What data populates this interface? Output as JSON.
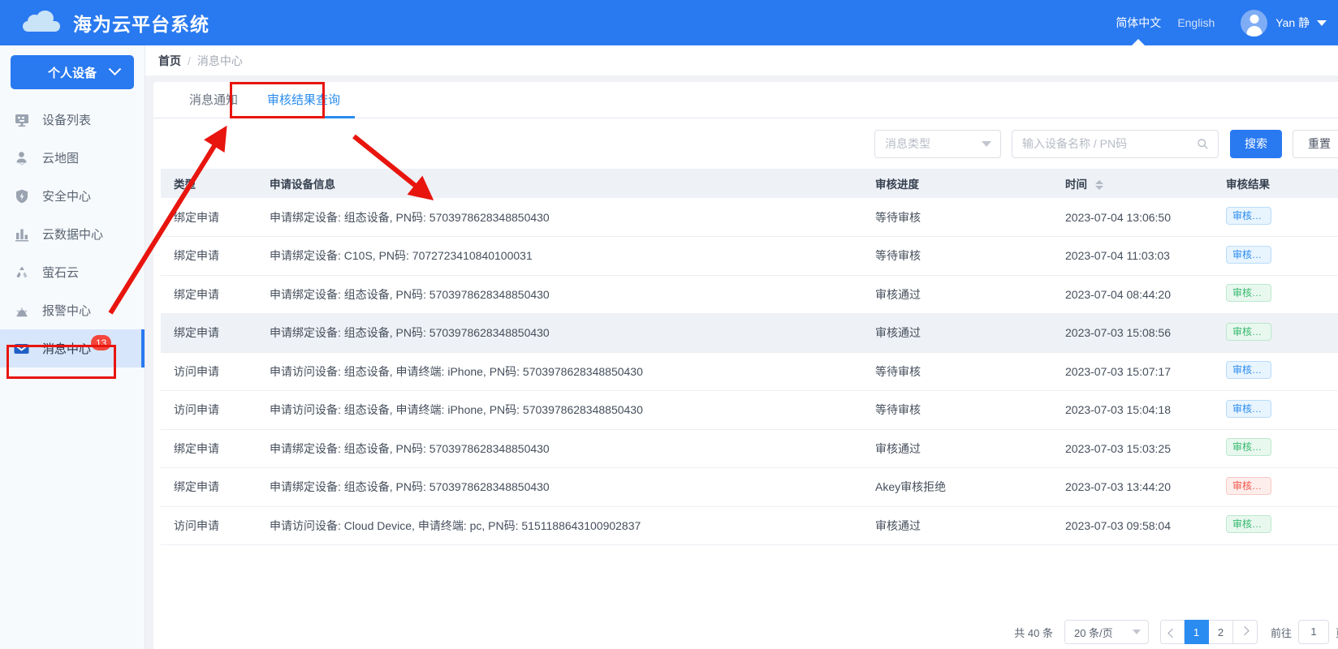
{
  "header": {
    "brand_title": "海为云平台系统",
    "lang_zh": "简体中文",
    "lang_en": "English",
    "user_name": "Yan 静",
    "brand_color": "#2979f0"
  },
  "sidebar": {
    "device_selector": "个人设备",
    "items": [
      {
        "label": "设备列表",
        "icon": "monitor-icon",
        "active": false
      },
      {
        "label": "云地图",
        "icon": "map-pin-icon",
        "active": false
      },
      {
        "label": "安全中心",
        "icon": "shield-icon",
        "active": false
      },
      {
        "label": "云数据中心",
        "icon": "bar-chart-icon",
        "active": false
      },
      {
        "label": "萤石云",
        "icon": "cloud-recycle-icon",
        "active": false
      },
      {
        "label": "报警中心",
        "icon": "alarm-icon",
        "active": false
      },
      {
        "label": "消息中心",
        "icon": "envelope-icon",
        "active": true,
        "badge": "13"
      }
    ]
  },
  "breadcrumb": {
    "home": "首页",
    "separator": "/",
    "current": "消息中心"
  },
  "tabs": [
    {
      "label": "消息通知",
      "active": false
    },
    {
      "label": "审核结果查询",
      "active": true
    }
  ],
  "toolbar": {
    "type_filter_placeholder": "消息类型",
    "search_placeholder": "输入设备名称 / PN码",
    "search_value": "",
    "search_button": "搜索",
    "reset_button": "重置",
    "search_icon": "magnifier-icon"
  },
  "table": {
    "columns": [
      "类型",
      "申请设备信息",
      "审核进度",
      "时间",
      "审核结果"
    ],
    "sortable_column": "时间",
    "rows": [
      {
        "type": "绑定申请",
        "info": "申请绑定设备: 组态设备, PN码: 5703978628348850430",
        "progress": "等待审核",
        "time": "2023-07-04 13:06:50",
        "result": "审核中...",
        "result_style": "blue",
        "hover": false
      },
      {
        "type": "绑定申请",
        "info": "申请绑定设备: C10S, PN码: 7072723410840100031",
        "progress": "等待审核",
        "time": "2023-07-04 11:03:03",
        "result": "审核中...",
        "result_style": "blue",
        "hover": false
      },
      {
        "type": "绑定申请",
        "info": "申请绑定设备: 组态设备, PN码: 5703978628348850430",
        "progress": "审核通过",
        "time": "2023-07-04 08:44:20",
        "result": "审核通过",
        "result_style": "green",
        "hover": false
      },
      {
        "type": "绑定申请",
        "info": "申请绑定设备: 组态设备, PN码: 5703978628348850430",
        "progress": "审核通过",
        "time": "2023-07-03 15:08:56",
        "result": "审核通过",
        "result_style": "green",
        "hover": true
      },
      {
        "type": "访问申请",
        "info": "申请访问设备: 组态设备, 申请终端: iPhone, PN码: 5703978628348850430",
        "progress": "等待审核",
        "time": "2023-07-03 15:07:17",
        "result": "审核中...",
        "result_style": "blue",
        "hover": false
      },
      {
        "type": "访问申请",
        "info": "申请访问设备: 组态设备, 申请终端: iPhone, PN码: 5703978628348850430",
        "progress": "等待审核",
        "time": "2023-07-03 15:04:18",
        "result": "审核中...",
        "result_style": "blue",
        "hover": false
      },
      {
        "type": "绑定申请",
        "info": "申请绑定设备: 组态设备, PN码: 5703978628348850430",
        "progress": "审核通过",
        "time": "2023-07-03 15:03:25",
        "result": "审核通过",
        "result_style": "green",
        "hover": false
      },
      {
        "type": "绑定申请",
        "info": "申请绑定设备: 组态设备, PN码: 5703978628348850430",
        "progress": "Akey审核拒绝",
        "time": "2023-07-03 13:44:20",
        "result": "审核拒绝",
        "result_style": "red",
        "hover": false
      },
      {
        "type": "访问申请",
        "info": "申请访问设备: Cloud Device, 申请终端: pc, PN码: 5151188643100902837",
        "progress": "审核通过",
        "time": "2023-07-03 09:58:04",
        "result": "审核通过",
        "result_style": "green",
        "hover": false
      }
    ]
  },
  "pagination": {
    "total_text": "共 40 条",
    "page_size": "20 条/页",
    "pages": [
      "1",
      "2"
    ],
    "current_page": "1",
    "goto_label": "前往",
    "goto_value": "1",
    "goto_unit": "页"
  },
  "annotations": {
    "color": "#e8150e",
    "boxes": [
      "tab-审核结果查询",
      "sidebar-消息中心"
    ],
    "arrows": [
      "sidebar-消息中心 → tab",
      "tab → table-header"
    ]
  }
}
